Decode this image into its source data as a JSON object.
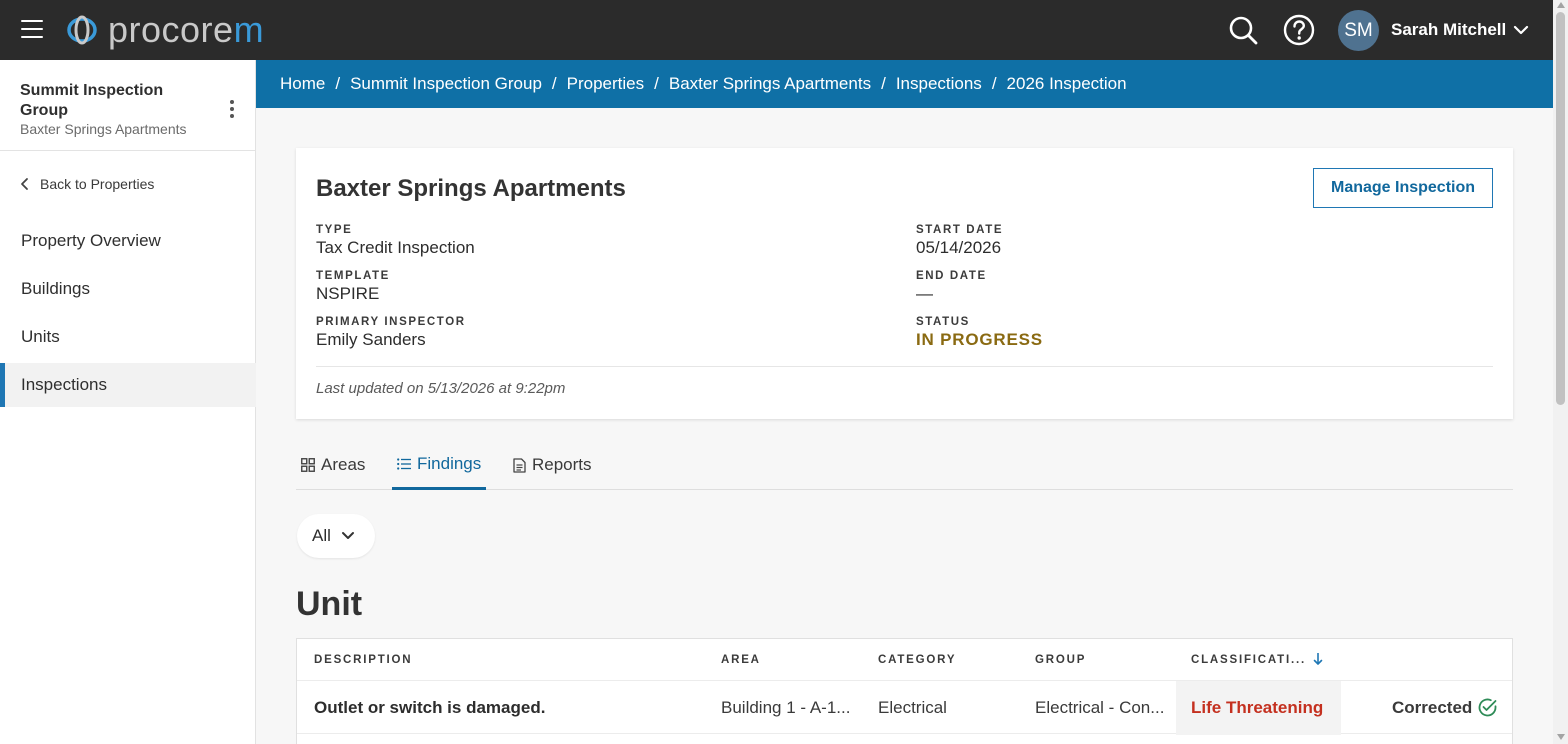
{
  "app": {
    "logo_text_main": "procore",
    "logo_text_accent": "m"
  },
  "user": {
    "initials": "SM",
    "name": "Sarah Mitchell"
  },
  "sidebar": {
    "org_name": "Summit Inspection Group",
    "org_sub": "Baxter Springs Apartments",
    "back_label": "Back to Properties",
    "items": [
      {
        "label": "Property Overview",
        "active": false
      },
      {
        "label": "Buildings",
        "active": false
      },
      {
        "label": "Units",
        "active": false
      },
      {
        "label": "Inspections",
        "active": true
      }
    ]
  },
  "breadcrumb": [
    "Home",
    "Summit Inspection Group",
    "Properties",
    "Baxter Springs Apartments",
    "Inspections",
    "2026 Inspection"
  ],
  "inspection": {
    "title": "Baxter Springs Apartments",
    "manage_label": "Manage Inspection",
    "type_label": "TYPE",
    "type_value": "Tax Credit Inspection",
    "template_label": "TEMPLATE",
    "template_value": "NSPIRE",
    "inspector_label": "PRIMARY INSPECTOR",
    "inspector_value": "Emily Sanders",
    "start_label": "START DATE",
    "start_value": "05/14/2026",
    "end_label": "END DATE",
    "end_value": "—",
    "status_label": "STATUS",
    "status_value": "IN PROGRESS",
    "status_color": "#8a6a12",
    "updated": "Last updated on 5/13/2026 at 9:22pm"
  },
  "tabs": [
    {
      "label": "Areas",
      "icon": "grid-icon",
      "active": false
    },
    {
      "label": "Findings",
      "icon": "list-icon",
      "active": true
    },
    {
      "label": "Reports",
      "icon": "document-icon",
      "active": false
    }
  ],
  "filter": {
    "selected": "All"
  },
  "section_title": "Unit",
  "table": {
    "columns": [
      "DESCRIPTION",
      "AREA",
      "CATEGORY",
      "GROUP",
      "CLASSIFICATI..."
    ],
    "sort_column": "CLASSIFICATI...",
    "sort_direction": "descending",
    "rows": [
      {
        "description": "Outlet or switch is damaged.",
        "area": "Building 1 - A-1...",
        "category": "Electrical",
        "group": "Electrical - Con...",
        "classification": "Life Threatening",
        "classification_color": "#c4301f",
        "status": "Corrected"
      }
    ]
  },
  "colors": {
    "topbar": "#2b2b2b",
    "accent": "#0f70a6",
    "link": "#11689d"
  }
}
